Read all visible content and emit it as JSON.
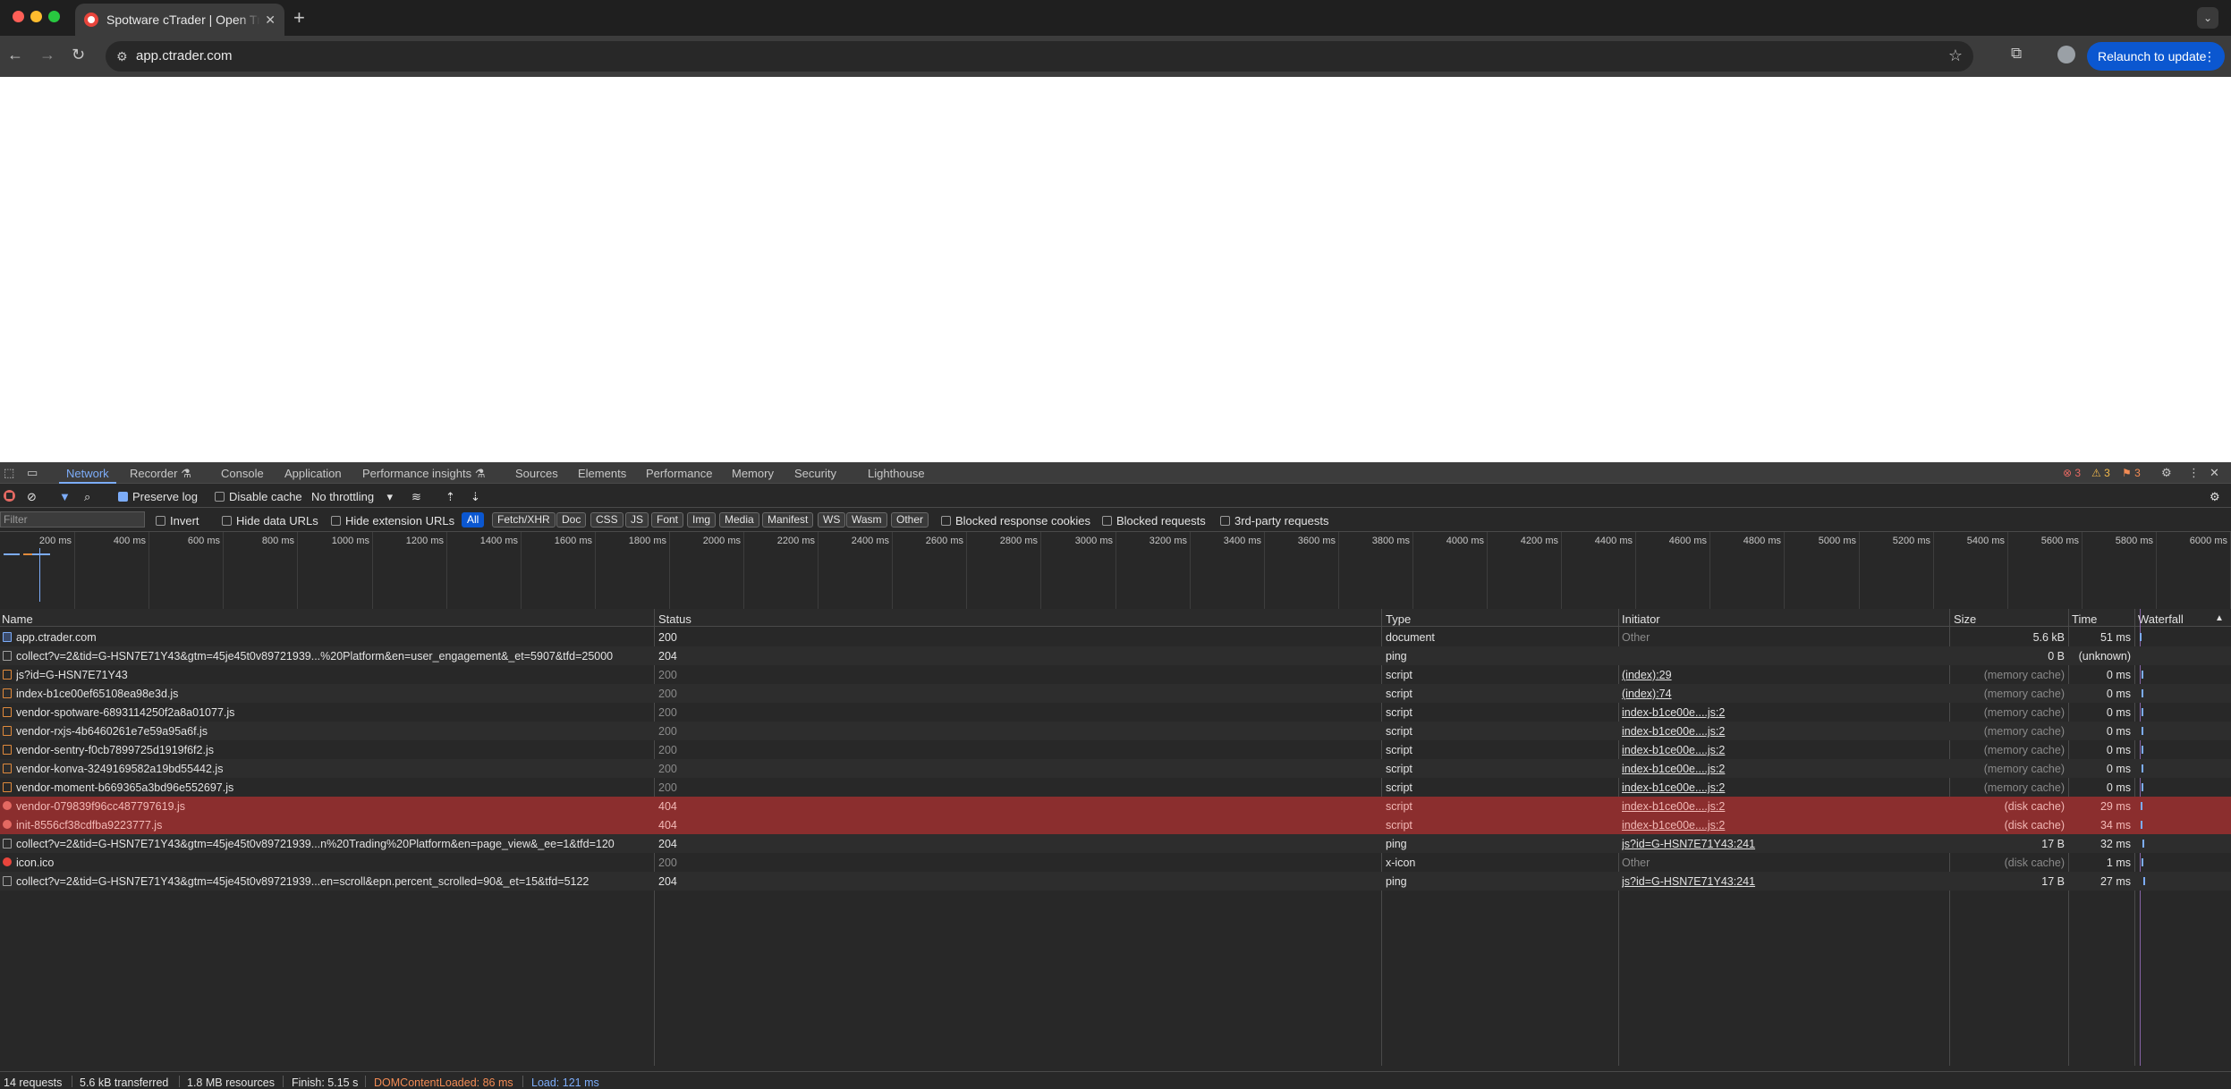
{
  "browser": {
    "tab_title": "Spotware cTrader | Open Trading Platform",
    "url": "app.ctrader.com",
    "relaunch_label": "Relaunch to update"
  },
  "devtools": {
    "tabs": [
      "Network",
      "Recorder",
      "Console",
      "Application",
      "Performance insights",
      "Sources",
      "Elements",
      "Performance",
      "Memory",
      "Security",
      "Lighthouse"
    ],
    "errors_count": "3",
    "warnings_count": "3",
    "issues_count": "3",
    "toolbar": {
      "preserve_log": "Preserve log",
      "disable_cache": "Disable cache",
      "throttling": "No throttling"
    },
    "filter": {
      "placeholder": "Filter",
      "invert": "Invert",
      "hide_data_urls": "Hide data URLs",
      "hide_extension_urls": "Hide extension URLs",
      "types": [
        "All",
        "Fetch/XHR",
        "Doc",
        "CSS",
        "JS",
        "Font",
        "Img",
        "Media",
        "Manifest",
        "WS",
        "Wasm",
        "Other"
      ],
      "blocked_response_cookies": "Blocked response cookies",
      "blocked_requests": "Blocked requests",
      "third_party_requests": "3rd-party requests"
    },
    "overview_ticks": [
      "200 ms",
      "400 ms",
      "600 ms",
      "800 ms",
      "1000 ms",
      "1200 ms",
      "1400 ms",
      "1600 ms",
      "1800 ms",
      "2000 ms",
      "2200 ms",
      "2400 ms",
      "2600 ms",
      "2800 ms",
      "3000 ms",
      "3200 ms",
      "3400 ms",
      "3600 ms",
      "3800 ms",
      "4000 ms",
      "4200 ms",
      "4400 ms",
      "4600 ms",
      "4800 ms",
      "5000 ms",
      "5200 ms",
      "5400 ms",
      "5600 ms",
      "5800 ms",
      "6000 ms"
    ],
    "columns": {
      "name": "Name",
      "status": "Status",
      "type": "Type",
      "initiator": "Initiator",
      "size": "Size",
      "time": "Time",
      "waterfall": "Waterfall"
    },
    "requests": [
      {
        "name": "app.ctrader.com",
        "status": "200",
        "type": "document",
        "initiator": "Other",
        "size": "5.6 kB",
        "time": "51 ms",
        "icon": "document-icon"
      },
      {
        "name": "collect?v=2&tid=G-HSN7E71Y43&gtm=45je45t0v89721939...%20Platform&en=user_engagement&_et=5907&tfd=25000",
        "status": "204",
        "type": "ping",
        "initiator": "",
        "size": "0 B",
        "time": "(unknown)",
        "icon": "ping-icon"
      },
      {
        "name": "js?id=G-HSN7E71Y43",
        "status": "200",
        "type": "script",
        "initiator": "(index):29",
        "size": "(memory cache)",
        "time": "0 ms",
        "icon": "script-icon"
      },
      {
        "name": "index-b1ce00ef65108ea98e3d.js",
        "status": "200",
        "type": "script",
        "initiator": "(index):74",
        "size": "(memory cache)",
        "time": "0 ms",
        "icon": "script-icon"
      },
      {
        "name": "vendor-spotware-6893114250f2a8a01077.js",
        "status": "200",
        "type": "script",
        "initiator": "index-b1ce00e....js:2",
        "size": "(memory cache)",
        "time": "0 ms",
        "icon": "script-icon"
      },
      {
        "name": "vendor-rxjs-4b6460261e7e59a95a6f.js",
        "status": "200",
        "type": "script",
        "initiator": "index-b1ce00e....js:2",
        "size": "(memory cache)",
        "time": "0 ms",
        "icon": "script-icon"
      },
      {
        "name": "vendor-sentry-f0cb7899725d1919f6f2.js",
        "status": "200",
        "type": "script",
        "initiator": "index-b1ce00e....js:2",
        "size": "(memory cache)",
        "time": "0 ms",
        "icon": "script-icon"
      },
      {
        "name": "vendor-konva-3249169582a19bd55442.js",
        "status": "200",
        "type": "script",
        "initiator": "index-b1ce00e....js:2",
        "size": "(memory cache)",
        "time": "0 ms",
        "icon": "script-icon"
      },
      {
        "name": "vendor-moment-b669365a3bd96e552697.js",
        "status": "200",
        "type": "script",
        "initiator": "index-b1ce00e....js:2",
        "size": "(memory cache)",
        "time": "0 ms",
        "icon": "script-icon"
      },
      {
        "name": "vendor-079839f96cc487797619.js",
        "status": "404",
        "type": "script",
        "initiator": "index-b1ce00e....js:2",
        "size": "(disk cache)",
        "time": "29 ms",
        "icon": "error-icon"
      },
      {
        "name": "init-8556cf38cdfba9223777.js",
        "status": "404",
        "type": "script",
        "initiator": "index-b1ce00e....js:2",
        "size": "(disk cache)",
        "time": "34 ms",
        "icon": "error-icon"
      },
      {
        "name": "collect?v=2&tid=G-HSN7E71Y43&gtm=45je45t0v89721939...n%20Trading%20Platform&en=page_view&_ee=1&tfd=120",
        "status": "204",
        "type": "ping",
        "initiator": "js?id=G-HSN7E71Y43:241",
        "size": "17 B",
        "time": "32 ms",
        "icon": "ping-icon"
      },
      {
        "name": "icon.ico",
        "status": "200",
        "type": "x-icon",
        "initiator": "Other",
        "size": "(disk cache)",
        "time": "1 ms",
        "icon": "image-icon"
      },
      {
        "name": "collect?v=2&tid=G-HSN7E71Y43&gtm=45je45t0v89721939...en=scroll&epn.percent_scrolled=90&_et=15&tfd=5122",
        "status": "204",
        "type": "ping",
        "initiator": "js?id=G-HSN7E71Y43:241",
        "size": "17 B",
        "time": "27 ms",
        "icon": "ping-icon"
      }
    ],
    "status_bar": {
      "requests": "14 requests",
      "transferred": "5.6 kB transferred",
      "resources": "1.8 MB resources",
      "finish": "Finish: 5.15 s",
      "dom_content_loaded": "DOMContentLoaded: 86 ms",
      "load": "Load: 121 ms"
    },
    "colors": {
      "accent": "#7cacf8",
      "error_row": "#8b2e2e",
      "dom_content_loaded": "#f28b54",
      "load": "#7cacf8"
    }
  }
}
